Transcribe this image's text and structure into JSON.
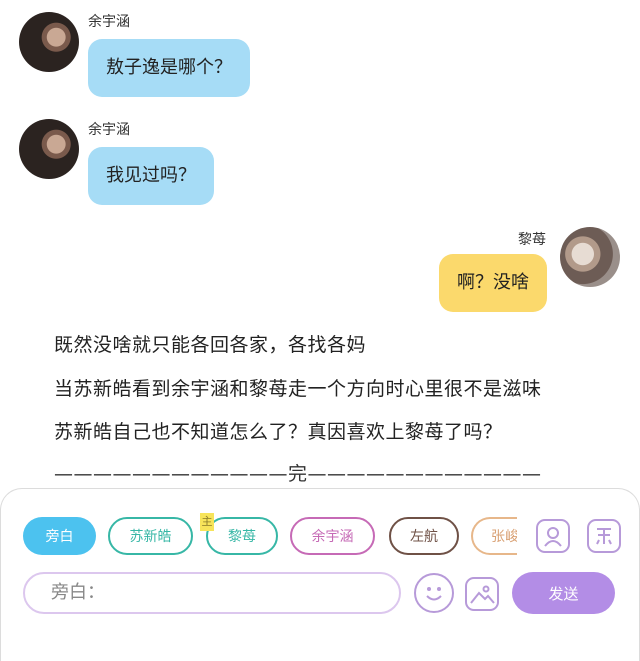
{
  "messages": [
    {
      "name": "余宇涵",
      "text": "敖子逸是哪个？"
    },
    {
      "name": "余宇涵",
      "text": "我见过吗？"
    },
    {
      "name": "黎苺",
      "text": "啊？没啥"
    }
  ],
  "narration": [
    "既然没啥就只能各回各家，各找各妈",
    "当苏新皓看到余宇涵和黎苺走一个方向时心里很不是滋味",
    "苏新皓自己也不知道怎么了？真因喜欢上黎苺了吗？",
    "————————————完————————————"
  ],
  "panel": {
    "chips": [
      "旁白",
      "苏新皓",
      "黎苺",
      "余宇涵",
      "左航",
      "张峻"
    ],
    "tag_mark": "主",
    "input_placeholder": "旁白：",
    "send_label": "发送",
    "colors": {
      "active": "#4cc2ef",
      "chip_borders": [
        "#4cc2ef",
        "#37b7a6",
        "#37b7a6",
        "#c66ab6",
        "#6f5146",
        "#e7b78a"
      ],
      "send": "#b38de6"
    }
  }
}
